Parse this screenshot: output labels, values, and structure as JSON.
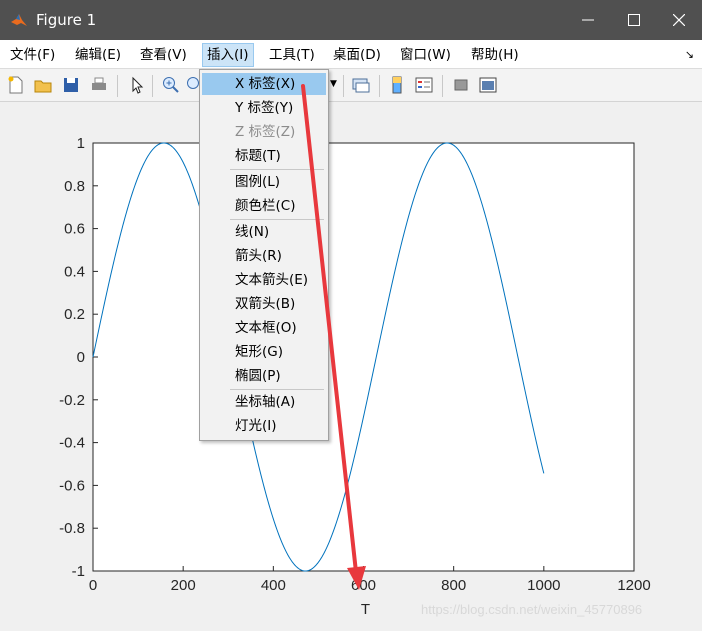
{
  "window": {
    "title": "Figure 1"
  },
  "menubar": {
    "items": [
      "文件(F)",
      "编辑(E)",
      "查看(V)",
      "插入(I)",
      "工具(T)",
      "桌面(D)",
      "窗口(W)",
      "帮助(H)"
    ],
    "active": "插入(I)"
  },
  "insert_menu": {
    "items": [
      {
        "label": "X 标签(X)",
        "highlighted": true
      },
      {
        "label": "Y 标签(Y)"
      },
      {
        "label": "Z 标签(Z)",
        "disabled": true
      },
      {
        "label": "标题(T)"
      },
      {
        "label": "图例(L)"
      },
      {
        "label": "颜色栏(C)"
      },
      {
        "label": "线(N)"
      },
      {
        "label": "箭头(R)"
      },
      {
        "label": "文本箭头(E)"
      },
      {
        "label": "双箭头(B)"
      },
      {
        "label": "文本框(O)"
      },
      {
        "label": "矩形(G)"
      },
      {
        "label": "椭圆(P)"
      },
      {
        "label": "坐标轴(A)"
      },
      {
        "label": "灯光(I)"
      }
    ]
  },
  "chart_data": {
    "type": "line",
    "xlabel": "T",
    "ylabel": "",
    "title": "",
    "xlim": [
      0,
      1200
    ],
    "ylim": [
      -1,
      1
    ],
    "xticks": [
      "0",
      "200",
      "400",
      "600",
      "800",
      "1000",
      "1200"
    ],
    "yticks": [
      "-1",
      "-0.8",
      "-0.6",
      "-0.4",
      "-0.2",
      "0",
      "0.2",
      "0.4",
      "0.6",
      "0.8",
      "1"
    ],
    "series": [
      {
        "function": "sin(x/100)",
        "x_range": [
          0,
          1000
        ],
        "color": "#0072bd"
      }
    ]
  },
  "annotation": {
    "arrow_color": "#e8383d"
  },
  "watermark": "https://blog.csdn.net/weixin_45770896"
}
